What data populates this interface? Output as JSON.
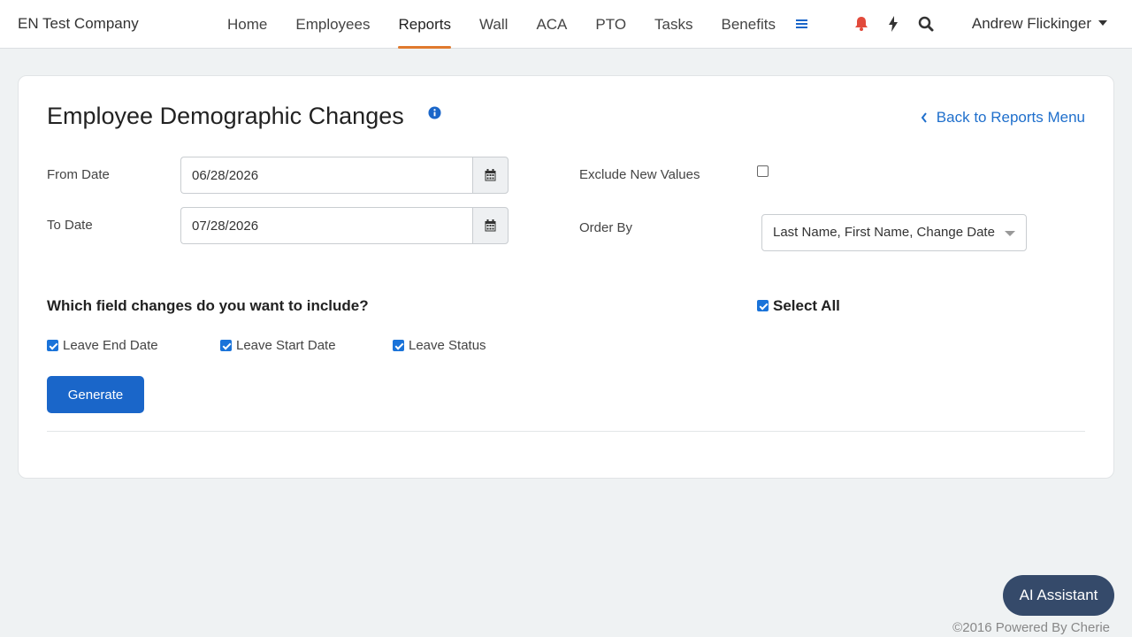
{
  "header": {
    "company": "EN Test Company",
    "nav": [
      {
        "label": "Home",
        "active": false
      },
      {
        "label": "Employees",
        "active": false
      },
      {
        "label": "Reports",
        "active": true
      },
      {
        "label": "Wall",
        "active": false
      },
      {
        "label": "ACA",
        "active": false
      },
      {
        "label": "PTO",
        "active": false
      },
      {
        "label": "Tasks",
        "active": false
      },
      {
        "label": "Benefits",
        "active": false
      }
    ],
    "icons": [
      "menu-icon",
      "bell-icon",
      "bolt-icon",
      "search-icon"
    ],
    "user_name": "Andrew Flickinger"
  },
  "page": {
    "title": "Employee Demographic Changes",
    "back_link": "Back to Reports Menu",
    "from_date_label": "From Date",
    "from_date_value": "06/28/2026",
    "to_date_label": "To Date",
    "to_date_value": "07/28/2026",
    "exclude_label": "Exclude New Values",
    "exclude_checked": false,
    "order_by_label": "Order By",
    "order_by_value": "Last Name, First Name, Change Date",
    "question": "Which field changes do you want to include?",
    "select_all_label": "Select All",
    "select_all_checked": true,
    "fields": [
      {
        "label": "Leave End Date",
        "checked": true
      },
      {
        "label": "Leave Start Date",
        "checked": true
      },
      {
        "label": "Leave Status",
        "checked": true
      }
    ],
    "generate_label": "Generate"
  },
  "ai_assistant_label": "AI Assistant",
  "footer": "©2016 Powered By Cherie",
  "colors": {
    "accent_blue": "#1a66c9",
    "active_tab_underline": "#e07a2e",
    "bell_red": "#e24a3b",
    "ai_button": "#354a6a"
  }
}
